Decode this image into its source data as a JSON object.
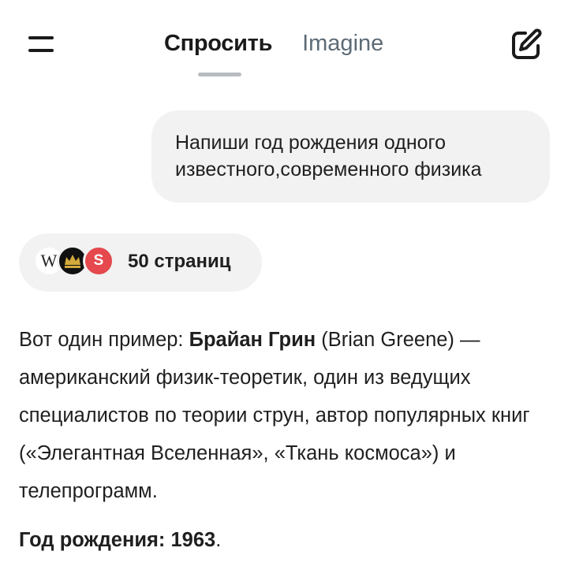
{
  "header": {
    "tabs": [
      {
        "label": "Спросить",
        "active": true
      },
      {
        "label": "Imagine",
        "active": false
      }
    ],
    "menu_icon": "hamburger-menu-icon",
    "edit_icon": "new-chat-edit-icon"
  },
  "conversation": {
    "user_message": {
      "line1": "Напиши год рождения одного",
      "line2": "известного,современного физика"
    },
    "sources": {
      "icons": [
        "wikipedia-icon",
        "crown-logo-icon",
        "s-logo-icon"
      ],
      "wiki_glyph": "W",
      "s_glyph": "S",
      "label": "50 страниц"
    },
    "answer": {
      "intro": "Вот один пример: ",
      "name_bold": "Брайан Грин",
      "rest": " (Brian Greene) — американский физик-теоретик, один из ведущих специалистов по теории струн, автор популярных книг («Элегантная Вселенная», «Ткань космоса») и телепрограмм.",
      "birth_label": "Год рождения: 1963",
      "birth_suffix": "."
    }
  },
  "colors": {
    "text": "#1a1a1a",
    "inactive_tab": "#5d6b76",
    "bubble_bg": "#f2f2f2",
    "indicator": "#b7bcc2",
    "source_red": "#e5484d"
  }
}
